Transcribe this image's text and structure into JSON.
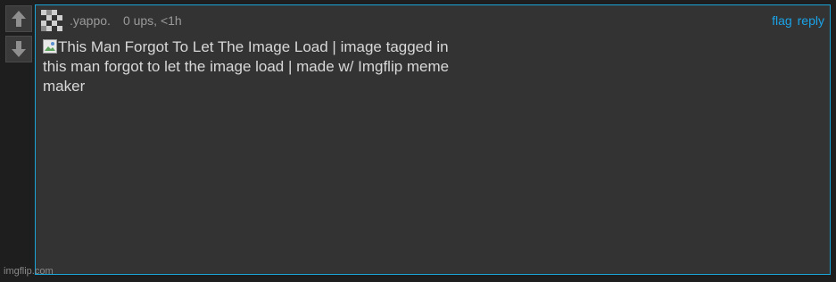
{
  "comment": {
    "username": ".yappo.",
    "meta": "0 ups, <1h",
    "actions": {
      "flag_label": "flag",
      "reply_label": "reply"
    },
    "body_text": "This Man Forgot To Let The Image Load | image tagged in this man forgot to let the image load | made w/ Imgflip meme maker"
  },
  "watermark": "imgflip.com",
  "colors": {
    "accent": "#1aa3e8",
    "box_border": "#1aa3d6",
    "box_bg": "#333333",
    "page_bg": "#1e1e1e"
  },
  "icons": {
    "upvote": "arrow-up-icon",
    "downvote": "arrow-down-icon",
    "avatar": "pixel-avatar-icon",
    "broken_image": "broken-image-icon"
  }
}
